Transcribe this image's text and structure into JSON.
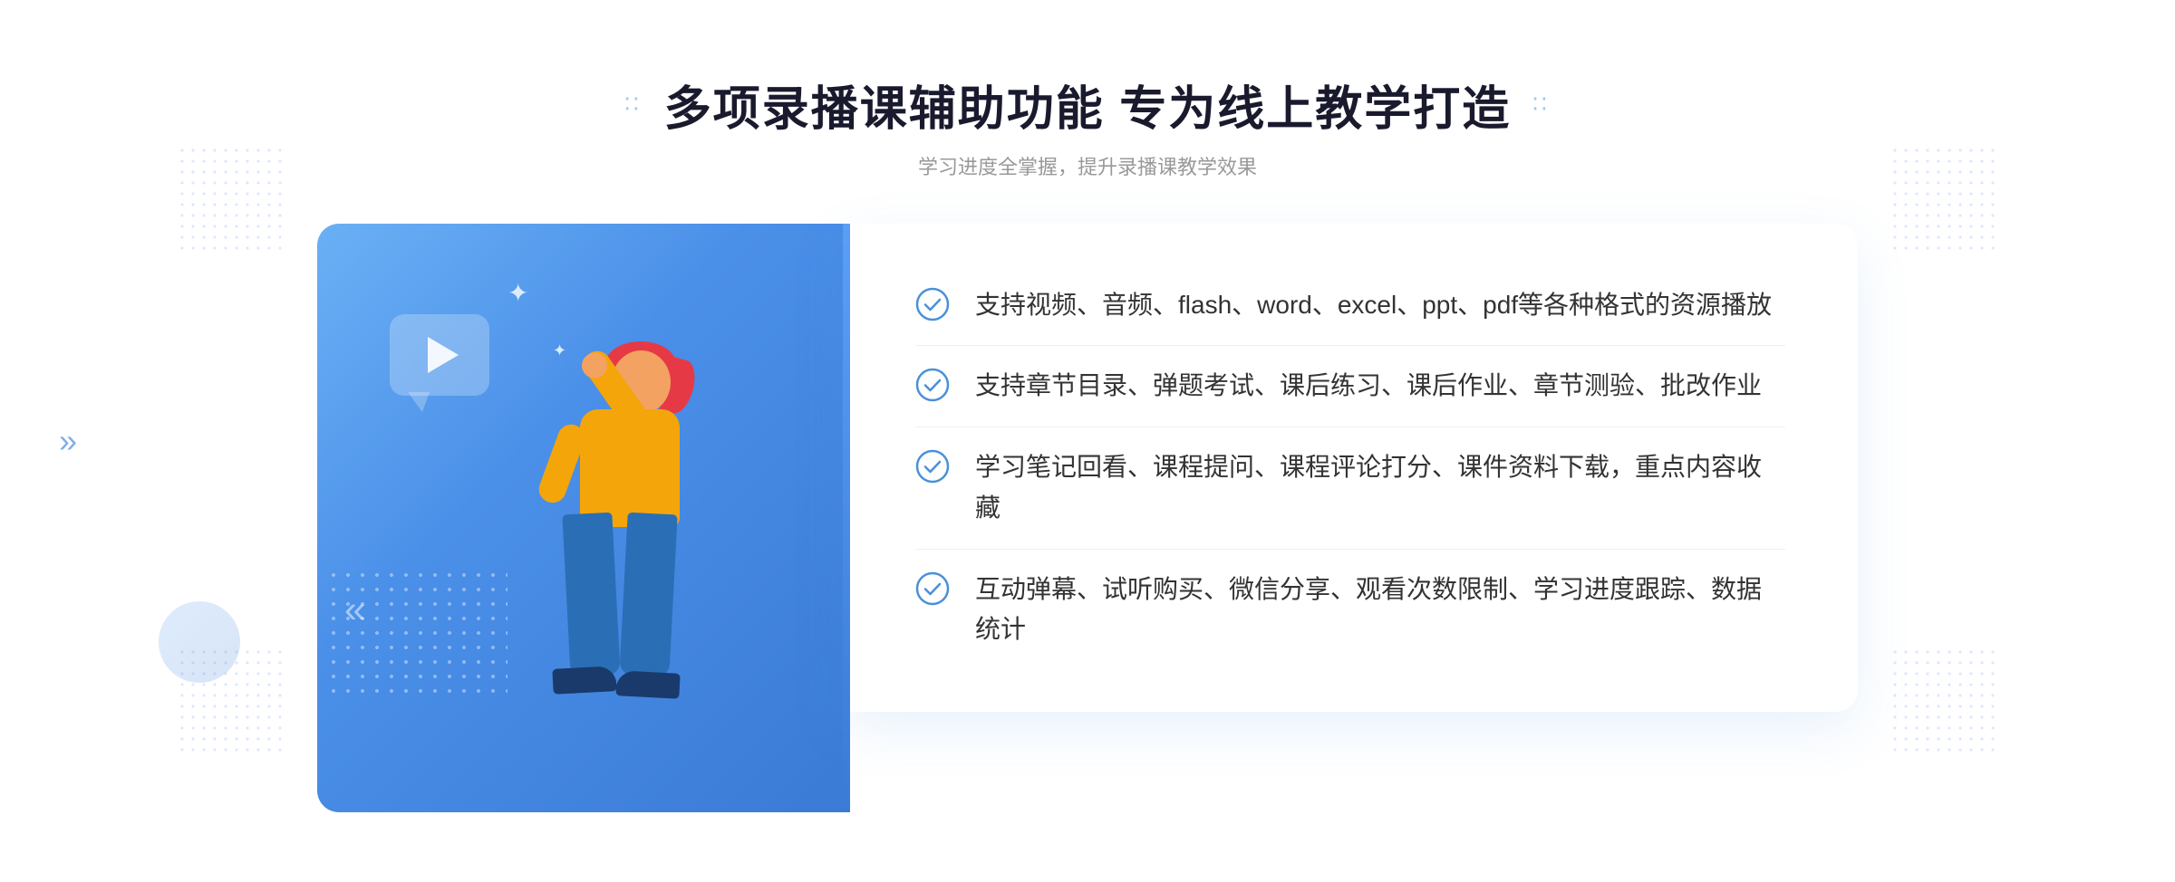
{
  "header": {
    "title_part1": "多项录播课辅助功能",
    "title_part2": "专为线上教学打造",
    "subtitle": "学习进度全掌握，提升录播课教学效果",
    "dots_char": "⁚⁚"
  },
  "features": [
    {
      "id": "feature-1",
      "text": "支持视频、音频、flash、word、excel、ppt、pdf等各种格式的资源播放"
    },
    {
      "id": "feature-2",
      "text": "支持章节目录、弹题考试、课后练习、课后作业、章节测验、批改作业"
    },
    {
      "id": "feature-3",
      "text": "学习笔记回看、课程提问、课程评论打分、课件资料下载，重点内容收藏"
    },
    {
      "id": "feature-4",
      "text": "互动弹幕、试听购买、微信分享、观看次数限制、学习进度跟踪、数据统计"
    }
  ]
}
